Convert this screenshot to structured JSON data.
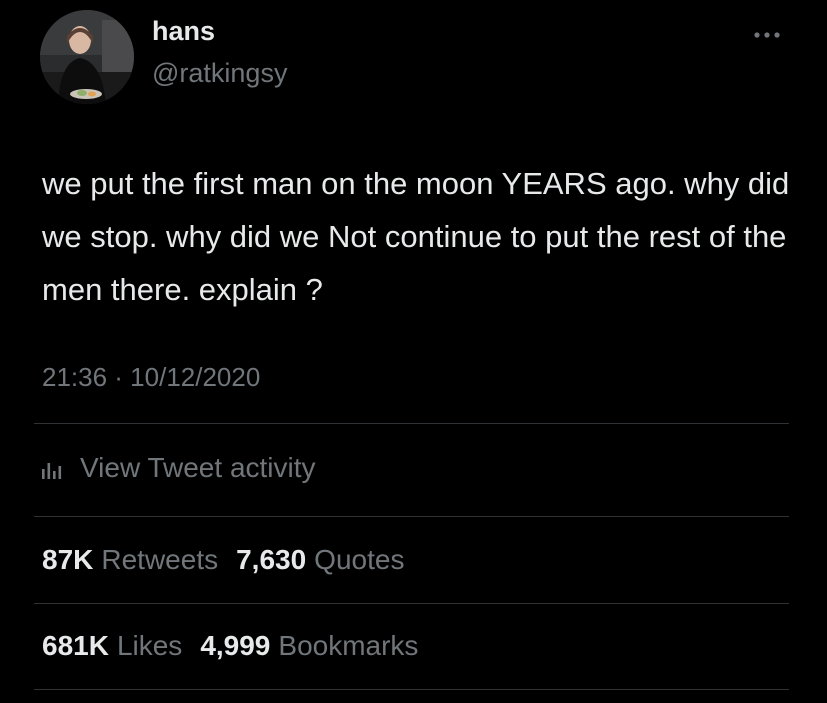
{
  "author": {
    "display_name": "hans",
    "handle": "@ratkingsy"
  },
  "tweet": {
    "text": "we put the first man on the moon YEARS ago. why did we stop. why did we Not continue to put the rest of the men there. explain ?",
    "timestamp": "21:36 · 10/12/2020"
  },
  "activity": {
    "label": "View Tweet activity",
    "icon": "bar-chart-icon"
  },
  "stats": {
    "retweets": {
      "count": "87K",
      "label": "Retweets"
    },
    "quotes": {
      "count": "7,630",
      "label": "Quotes"
    },
    "likes": {
      "count": "681K",
      "label": "Likes"
    },
    "bookmarks": {
      "count": "4,999",
      "label": "Bookmarks"
    }
  },
  "colors": {
    "background": "#000000",
    "primary_text": "#e7e9ea",
    "secondary_text": "#71767b",
    "divider": "#2f3336"
  }
}
